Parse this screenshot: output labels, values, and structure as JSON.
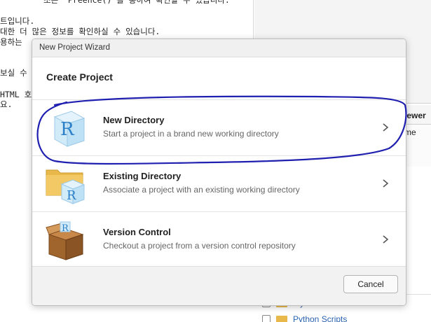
{
  "console": {
    "lines": [
      "조는 `Preence()`를 통하여 확인할 수 있습니다.",
      "트입니다.",
      "대한 더 많은 정보를 확인하실 수 있습니다.",
      "용하는",
      "보실 수",
      "HTML 호",
      "요."
    ]
  },
  "viewer": {
    "tab_label": "iewer",
    "sub_label": "me"
  },
  "files": {
    "items": [
      {
        "label": "My Videos"
      },
      {
        "label": "Python Scripts"
      }
    ]
  },
  "dialog": {
    "title": "New Project Wizard",
    "header": "Create Project",
    "options": [
      {
        "title": "New Directory",
        "description": "Start a project in a brand new working directory",
        "icon": "r-cube-icon"
      },
      {
        "title": "Existing Directory",
        "description": "Associate a project with an existing working directory",
        "icon": "folder-r-cube-icon"
      },
      {
        "title": "Version Control",
        "description": "Checkout a project from a version control repository",
        "icon": "box-r-icon"
      }
    ],
    "cancel_label": "Cancel"
  },
  "colors": {
    "annotation": "#1f1fb0",
    "r_blue": "#2b7fc8",
    "folder": "#e8b84a",
    "box_brown": "#a0652c"
  }
}
